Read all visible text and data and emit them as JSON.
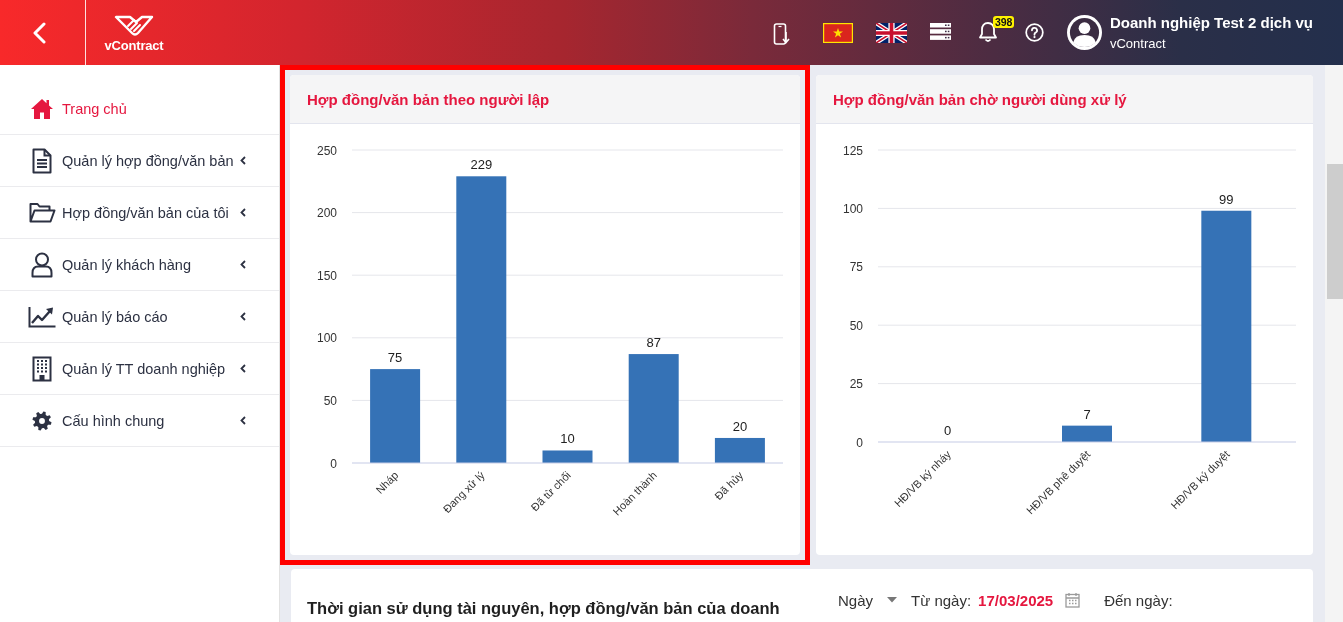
{
  "header": {
    "logo": {
      "text": "vContract"
    },
    "languages": [
      {
        "selected": true
      },
      {
        "selected": false
      }
    ],
    "notifications": {
      "count": "398"
    },
    "user": {
      "name": "Doanh nghiệp Test 2 dịch vụ",
      "organization": "vContract"
    }
  },
  "sidebar": {
    "items": [
      {
        "label": "Trang chủ",
        "selected": true,
        "submenu": false
      },
      {
        "label": "Quản lý hợp đồng/văn bản",
        "selected": false,
        "submenu": true
      },
      {
        "label": "Hợp đồng/văn bản của tôi",
        "selected": false,
        "submenu": true
      },
      {
        "label": "Quản lý khách hàng",
        "selected": false,
        "submenu": true
      },
      {
        "label": "Quản lý báo cáo",
        "selected": false,
        "submenu": true
      },
      {
        "label": "Quản lý TT doanh nghiệp",
        "selected": false,
        "submenu": true
      },
      {
        "label": "Cấu hình chung",
        "selected": false,
        "submenu": true
      }
    ]
  },
  "cards": [
    {
      "title": "Hợp đồng/văn bản theo người lập",
      "highlighted": true,
      "chart_data": {
        "type": "bar",
        "categories": [
          "Nháp",
          "Đang xử lý",
          "Đã từ chối",
          "Hoàn thành",
          "Đã hủy"
        ],
        "values": [
          75,
          229,
          10,
          87,
          20
        ],
        "ylim": [
          0,
          250
        ],
        "yticks": [
          0,
          50,
          100,
          150,
          200,
          250
        ],
        "grid": true,
        "data_labels": true
      }
    },
    {
      "title": "Hợp đồng/văn bản chờ người dùng xử lý",
      "highlighted": false,
      "chart_data": {
        "type": "bar",
        "categories": [
          "HĐ/VB ký nháy",
          "HĐ/VB phê duyệt",
          "HĐ/VB ký duyệt"
        ],
        "values": [
          0,
          7,
          99
        ],
        "ylim": [
          0,
          125
        ],
        "yticks": [
          0,
          25,
          50,
          75,
          100,
          125
        ],
        "grid": true,
        "data_labels": true
      }
    }
  ],
  "usage_panel": {
    "title": "Thời gian sử dụng tài nguyên, hợp đồng/văn bản của doanh",
    "period": {
      "value": "Ngày"
    },
    "from_date": {
      "label": "Từ ngày:",
      "value": "17/03/2025"
    },
    "to_date": {
      "label": "Đến ngày:"
    }
  }
}
